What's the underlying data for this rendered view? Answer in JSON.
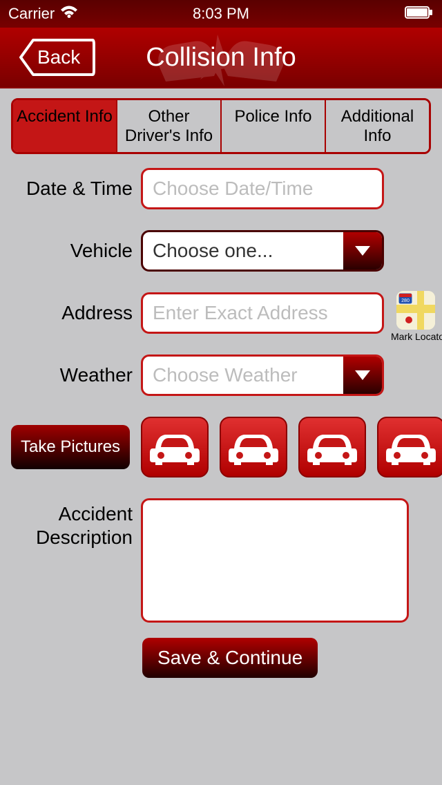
{
  "status": {
    "carrier": "Carrier",
    "time": "8:03 PM"
  },
  "nav": {
    "back": "Back",
    "title": "Collision Info"
  },
  "tabs": [
    {
      "label": "Accident Info",
      "active": true
    },
    {
      "label": "Other Driver's Info",
      "active": false
    },
    {
      "label": "Police Info",
      "active": false
    },
    {
      "label": "Additional Info",
      "active": false
    }
  ],
  "form": {
    "datetime": {
      "label": "Date & Time",
      "placeholder": "Choose Date/Time",
      "value": ""
    },
    "vehicle": {
      "label": "Vehicle",
      "selected": "Choose one..."
    },
    "address": {
      "label": "Address",
      "placeholder": "Enter Exact Address",
      "value": "",
      "locator_label": "Mark Locator"
    },
    "weather": {
      "label": "Weather",
      "selected": "Choose Weather"
    },
    "pictures": {
      "button": "Take Pictures",
      "slots": 4
    },
    "description": {
      "label_line1": "Accident",
      "label_line2": "Description",
      "value": ""
    },
    "save": "Save & Continue"
  },
  "colors": {
    "brand_red": "#b00000",
    "accent_red": "#c41616"
  }
}
